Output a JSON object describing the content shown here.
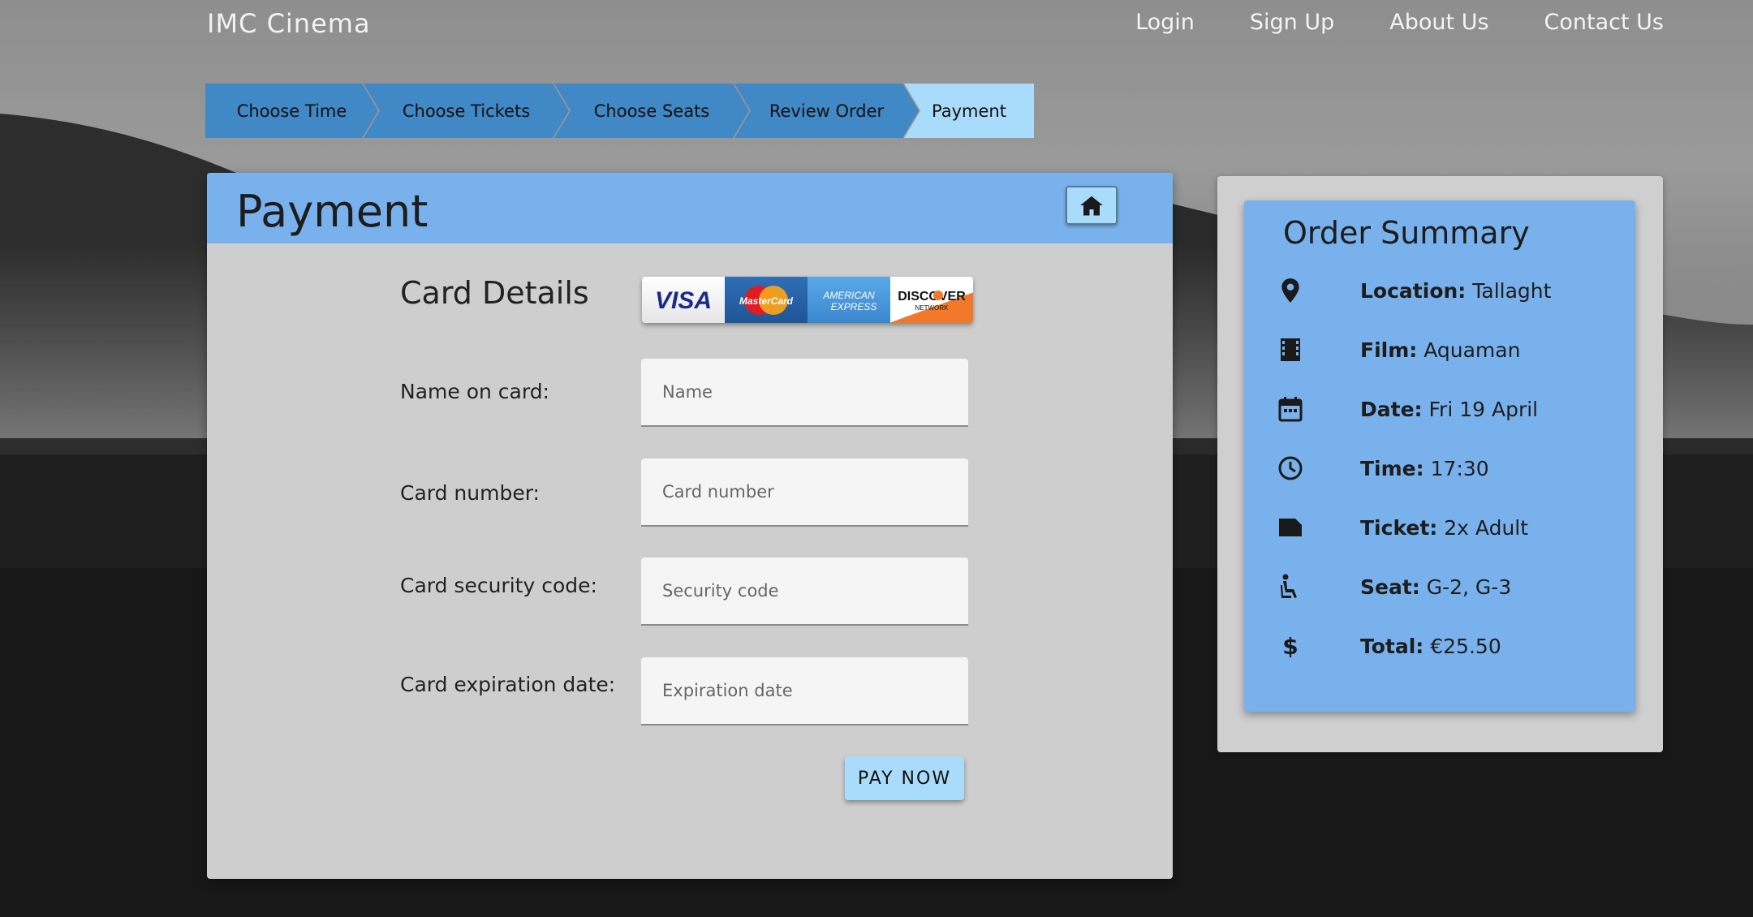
{
  "brand": "IMC Cinema",
  "nav": {
    "login": "Login",
    "signup": "Sign Up",
    "about": "About Us",
    "contact": "Contact Us"
  },
  "steps": [
    {
      "label": "Choose Time",
      "active": false
    },
    {
      "label": "Choose Tickets",
      "active": false
    },
    {
      "label": "Choose Seats",
      "active": false
    },
    {
      "label": "Review Order",
      "active": false
    },
    {
      "label": "Payment",
      "active": true
    }
  ],
  "payment": {
    "title": "Payment",
    "section_title": "Card Details",
    "card_brands": [
      "VISA",
      "MasterCard",
      "AMERICAN EXPRESS",
      "DISCOVER NETWORK"
    ],
    "fields": [
      {
        "label": "Name on card:",
        "placeholder": "Name",
        "value": ""
      },
      {
        "label": "Card number:",
        "placeholder": "Card number",
        "value": ""
      },
      {
        "label": "Card security code:",
        "placeholder": "Security code",
        "value": ""
      },
      {
        "label": "Card expiration date:",
        "placeholder": "Expiration date",
        "value": ""
      }
    ],
    "pay_button": "PAY NOW"
  },
  "summary": {
    "title": "Order Summary",
    "rows": [
      {
        "icon": "location-pin-icon",
        "key": "Location:",
        "value": " Tallaght"
      },
      {
        "icon": "film-icon",
        "key": "Film:",
        "value": " Aquaman"
      },
      {
        "icon": "calendar-icon",
        "key": "Date:",
        "value": " Fri 19 April"
      },
      {
        "icon": "clock-icon",
        "key": "Time:",
        "value": " 17:30"
      },
      {
        "icon": "ticket-icon",
        "key": "Ticket:",
        "value": " 2x Adult"
      },
      {
        "icon": "seat-icon",
        "key": "Seat:",
        "value": " G-2, G-3"
      },
      {
        "icon": "dollar-icon",
        "key": "Total:",
        "value": " €25.50"
      }
    ]
  },
  "colors": {
    "header_blue": "#79b1ec",
    "step_blue": "#4088c6",
    "step_active": "#a9dcfa",
    "button": "#a9dcfa",
    "panel_grey": "#cecece"
  }
}
